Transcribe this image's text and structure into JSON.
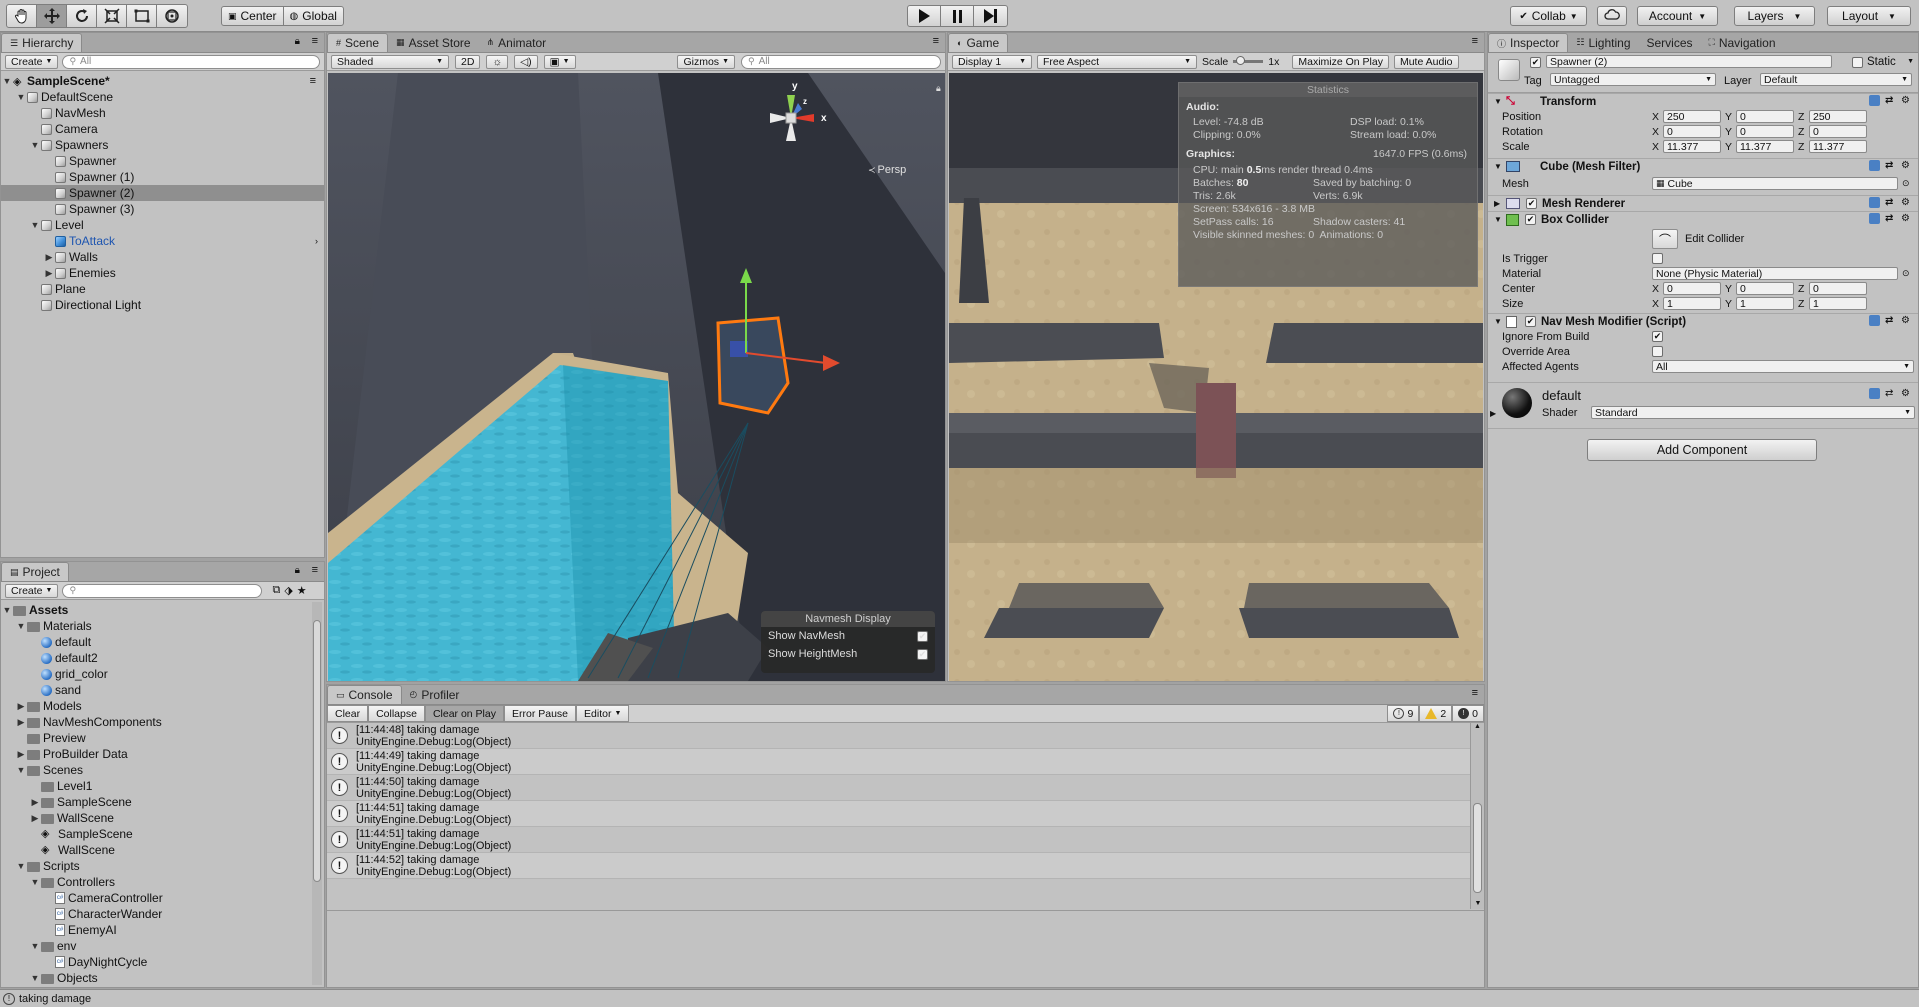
{
  "toolbar": {
    "tools": [
      "hand-tool",
      "move-tool",
      "rotate-tool",
      "scale-tool",
      "rect-tool",
      "transform-tool"
    ],
    "pivot_label": "Center",
    "space_label": "Global",
    "collab_label": "Collab",
    "account_label": "Account",
    "layers_label": "Layers",
    "layout_label": "Layout"
  },
  "hierarchy": {
    "tab": "Hierarchy",
    "create_label": "Create",
    "search_placeholder": "All",
    "scene_name": "SampleScene*",
    "items": [
      {
        "label": "DefaultScene",
        "indent": 1,
        "arrow": "▼",
        "icon": "cube",
        "selected": false
      },
      {
        "label": "NavMesh",
        "indent": 2,
        "arrow": "",
        "icon": "cube",
        "selected": false
      },
      {
        "label": "Camera",
        "indent": 2,
        "arrow": "",
        "icon": "cube",
        "selected": false
      },
      {
        "label": "Spawners",
        "indent": 2,
        "arrow": "▼",
        "icon": "cube",
        "selected": false
      },
      {
        "label": "Spawner",
        "indent": 3,
        "arrow": "",
        "icon": "cube",
        "selected": false
      },
      {
        "label": "Spawner (1)",
        "indent": 3,
        "arrow": "",
        "icon": "cube",
        "selected": false
      },
      {
        "label": "Spawner (2)",
        "indent": 3,
        "arrow": "",
        "icon": "cube",
        "selected": true
      },
      {
        "label": "Spawner (3)",
        "indent": 3,
        "arrow": "",
        "icon": "cube",
        "selected": false
      },
      {
        "label": "Level",
        "indent": 2,
        "arrow": "▼",
        "icon": "cube",
        "selected": false
      },
      {
        "label": "ToAttack",
        "indent": 3,
        "arrow": "",
        "icon": "cube-blue",
        "selected": false
      },
      {
        "label": "Walls",
        "indent": 3,
        "arrow": "▶",
        "icon": "cube",
        "selected": false
      },
      {
        "label": "Enemies",
        "indent": 3,
        "arrow": "▶",
        "icon": "cube",
        "selected": false
      },
      {
        "label": "Plane",
        "indent": 2,
        "arrow": "",
        "icon": "cube",
        "selected": false
      },
      {
        "label": "Directional Light",
        "indent": 2,
        "arrow": "",
        "icon": "cube",
        "selected": false
      }
    ]
  },
  "project": {
    "tab": "Project",
    "create_label": "Create",
    "items": [
      {
        "label": "Assets",
        "indent": 0,
        "arrow": "▼",
        "icon": "folder",
        "bold": true
      },
      {
        "label": "Materials",
        "indent": 1,
        "arrow": "▼",
        "icon": "folder"
      },
      {
        "label": "default",
        "indent": 2,
        "arrow": "",
        "icon": "ball"
      },
      {
        "label": "default2",
        "indent": 2,
        "arrow": "",
        "icon": "ball"
      },
      {
        "label": "grid_color",
        "indent": 2,
        "arrow": "",
        "icon": "ball"
      },
      {
        "label": "sand",
        "indent": 2,
        "arrow": "",
        "icon": "ball"
      },
      {
        "label": "Models",
        "indent": 1,
        "arrow": "▶",
        "icon": "folder"
      },
      {
        "label": "NavMeshComponents",
        "indent": 1,
        "arrow": "▶",
        "icon": "folder"
      },
      {
        "label": "Preview",
        "indent": 1,
        "arrow": "",
        "icon": "folder"
      },
      {
        "label": "ProBuilder Data",
        "indent": 1,
        "arrow": "▶",
        "icon": "folder"
      },
      {
        "label": "Scenes",
        "indent": 1,
        "arrow": "▼",
        "icon": "folder"
      },
      {
        "label": "Level1",
        "indent": 2,
        "arrow": "",
        "icon": "folder"
      },
      {
        "label": "SampleScene",
        "indent": 2,
        "arrow": "▶",
        "icon": "folder"
      },
      {
        "label": "WallScene",
        "indent": 2,
        "arrow": "▶",
        "icon": "folder"
      },
      {
        "label": "SampleScene",
        "indent": 2,
        "arrow": "",
        "icon": "unity"
      },
      {
        "label": "WallScene",
        "indent": 2,
        "arrow": "",
        "icon": "unity"
      },
      {
        "label": "Scripts",
        "indent": 1,
        "arrow": "▼",
        "icon": "folder"
      },
      {
        "label": "Controllers",
        "indent": 2,
        "arrow": "▼",
        "icon": "folder"
      },
      {
        "label": "CameraController",
        "indent": 3,
        "arrow": "",
        "icon": "cs"
      },
      {
        "label": "CharacterWander",
        "indent": 3,
        "arrow": "",
        "icon": "cs"
      },
      {
        "label": "EnemyAI",
        "indent": 3,
        "arrow": "",
        "icon": "cs"
      },
      {
        "label": "env",
        "indent": 2,
        "arrow": "▼",
        "icon": "folder"
      },
      {
        "label": "DayNightCycle",
        "indent": 3,
        "arrow": "",
        "icon": "cs"
      },
      {
        "label": "Objects",
        "indent": 2,
        "arrow": "▼",
        "icon": "folder"
      }
    ]
  },
  "scene": {
    "tabs": [
      "Scene",
      "Asset Store",
      "Animator"
    ],
    "shading": "Shaded",
    "mode_2d": "2D",
    "gizmos_label": "Gizmos",
    "search_placeholder": "All",
    "persp_label": "Persp",
    "gizmo_y": "y",
    "gizmo_x": "x",
    "gizmo_z": "z",
    "navmesh_display": {
      "title": "Navmesh Display",
      "show_navmesh": "Show NavMesh",
      "show_heightmesh": "Show HeightMesh"
    }
  },
  "game": {
    "tab": "Game",
    "display": "Display 1",
    "aspect": "Free Aspect",
    "scale_label": "Scale",
    "scale_value": "1x",
    "maximize": "Maximize On Play",
    "mute": "Mute Audio",
    "stats": {
      "title": "Statistics",
      "audio_header": "Audio:",
      "level": "Level: -74.8 dB",
      "clipping": "Clipping: 0.0%",
      "dsp": "DSP load: 0.1%",
      "stream": "Stream load: 0.0%",
      "graphics_header": "Graphics:",
      "fps": "1647.0 FPS (0.6ms)",
      "cpu_prefix": "CPU: main",
      "cpu_main": "0.5",
      "cpu_suffix": "ms  render thread 0.4ms",
      "batches_prefix": "Batches:",
      "batches_value": "80",
      "saved_batching": "Saved by batching: 0",
      "tris": "Tris: 2.6k",
      "verts": "Verts: 6.9k",
      "screen": "Screen: 534x616 - 3.8 MB",
      "setpass": "SetPass calls: 16",
      "shadow_casters": "Shadow casters: 41",
      "skinned": "Visible skinned meshes: 0",
      "animations": "Animations: 0"
    }
  },
  "inspector": {
    "tabs": [
      "Inspector",
      "Lighting",
      "Services",
      "Navigation"
    ],
    "object_name": "Spawner (2)",
    "static_label": "Static",
    "tag_label": "Tag",
    "tag_value": "Untagged",
    "layer_label": "Layer",
    "layer_value": "Default",
    "transform": {
      "title": "Transform",
      "position_label": "Position",
      "position": [
        "250",
        "0",
        "250"
      ],
      "rotation_label": "Rotation",
      "rotation": [
        "0",
        "0",
        "0"
      ],
      "scale_label": "Scale",
      "scale": [
        "11.377",
        "11.377",
        "11.377"
      ]
    },
    "mesh_filter": {
      "title": "Cube (Mesh Filter)",
      "mesh_label": "Mesh",
      "mesh_value": "Cube"
    },
    "mesh_renderer": {
      "title": "Mesh Renderer"
    },
    "box_collider": {
      "title": "Box Collider",
      "edit_collider": "Edit Collider",
      "is_trigger": "Is Trigger",
      "material_label": "Material",
      "material_value": "None (Physic Material)",
      "center_label": "Center",
      "center": [
        "0",
        "0",
        "0"
      ],
      "size_label": "Size",
      "size": [
        "1",
        "1",
        "1"
      ]
    },
    "nav_mesh_modifier": {
      "title": "Nav Mesh Modifier (Script)",
      "ignore_from_build": "Ignore From Build",
      "override_area": "Override Area",
      "affected_agents_label": "Affected Agents",
      "affected_agents_value": "All"
    },
    "material": {
      "name": "default",
      "shader_label": "Shader",
      "shader_value": "Standard"
    },
    "add_component": "Add Component",
    "axis_x": "X",
    "axis_y": "Y",
    "axis_z": "Z"
  },
  "console": {
    "tabs": [
      "Console",
      "Profiler"
    ],
    "buttons": [
      "Clear",
      "Collapse",
      "Clear on Play",
      "Error Pause",
      "Editor"
    ],
    "count_log": "9",
    "count_warn": "2",
    "count_err": "0",
    "lines": [
      {
        "time": "[11:44:48] taking damage",
        "trace": "UnityEngine.Debug:Log(Object)"
      },
      {
        "time": "[11:44:49] taking damage",
        "trace": "UnityEngine.Debug:Log(Object)"
      },
      {
        "time": "[11:44:50] taking damage",
        "trace": "UnityEngine.Debug:Log(Object)"
      },
      {
        "time": "[11:44:51] taking damage",
        "trace": "UnityEngine.Debug:Log(Object)"
      },
      {
        "time": "[11:44:51] taking damage",
        "trace": "UnityEngine.Debug:Log(Object)"
      },
      {
        "time": "[11:44:52] taking damage",
        "trace": "UnityEngine.Debug:Log(Object)"
      }
    ]
  },
  "status_bar": {
    "message": "taking damage"
  },
  "colors": {
    "selected_row": "#8f8f8f",
    "accent_blue": "#3d7bd6",
    "water": "#3fa9c4",
    "sand": "#c7b795"
  }
}
